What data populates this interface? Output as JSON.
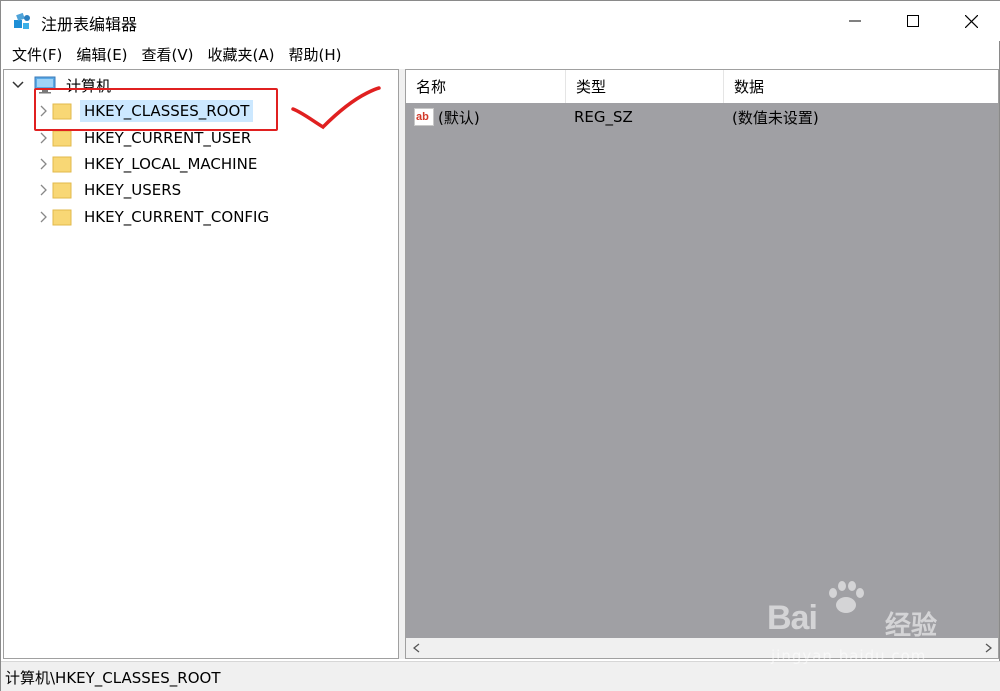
{
  "window": {
    "title": "注册表编辑器",
    "icon": "registry-editor-icon"
  },
  "menu": [
    "文件(F)",
    "编辑(E)",
    "查看(V)",
    "收藏夹(A)",
    "帮助(H)"
  ],
  "tree": {
    "root_label": "计算机",
    "items": [
      {
        "label": "HKEY_CLASSES_ROOT",
        "selected": true
      },
      {
        "label": "HKEY_CURRENT_USER",
        "selected": false
      },
      {
        "label": "HKEY_LOCAL_MACHINE",
        "selected": false
      },
      {
        "label": "HKEY_USERS",
        "selected": false
      },
      {
        "label": "HKEY_CURRENT_CONFIG",
        "selected": false
      }
    ]
  },
  "list": {
    "columns": [
      "名称",
      "类型",
      "数据"
    ],
    "rows": [
      {
        "name": "(默认)",
        "type": "REG_SZ",
        "data": "(数值未设置)"
      }
    ]
  },
  "status": {
    "path": "计算机\\HKEY_CLASSES_ROOT"
  },
  "watermark": {
    "brand": "Bai",
    "brand_cn": "经验",
    "url": "jingyan.baidu.com"
  },
  "colors": {
    "selection": "#cce8ff",
    "list_background": "#a0a0a4",
    "annotation_red": "#e02020",
    "folder_yellow": "#f8d775"
  }
}
